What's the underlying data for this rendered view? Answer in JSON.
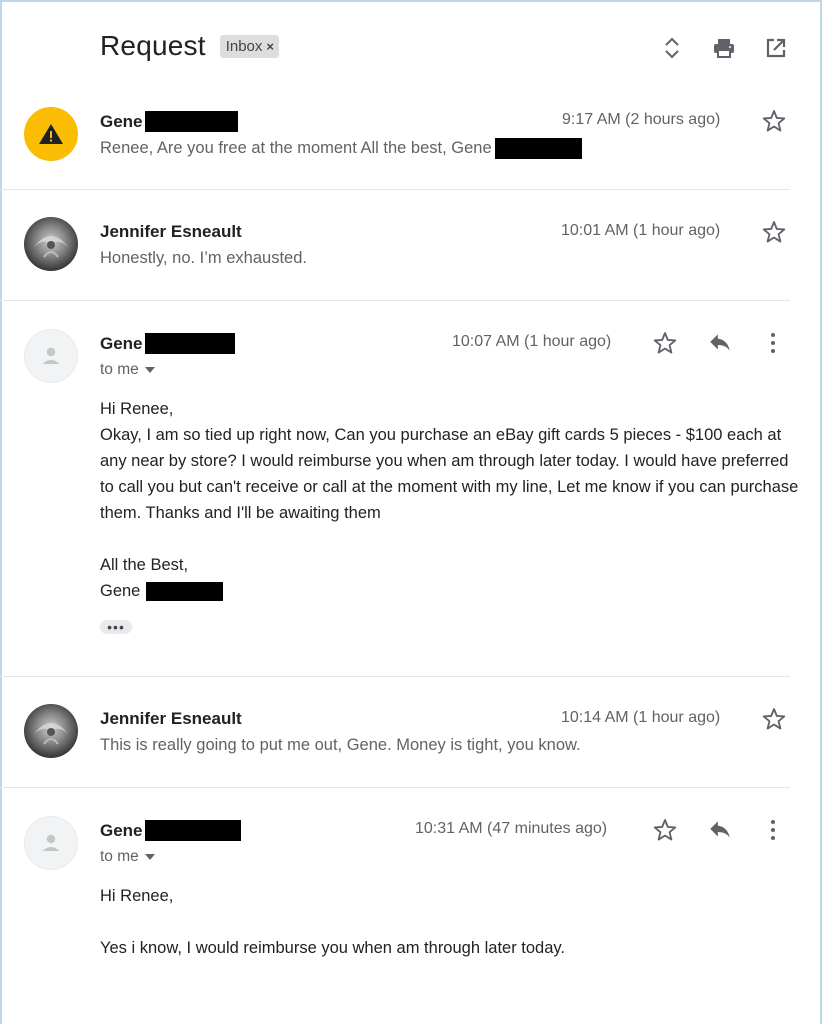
{
  "thread": {
    "subject": "Request",
    "label": "Inbox",
    "label_close": "×"
  },
  "toolbar_icons": [
    "expand-collapse-icon",
    "print-icon",
    "open-in-new-window-icon"
  ],
  "messages": [
    {
      "sender": "Gene",
      "time": "9:17 AM (2 hours ago)",
      "snippet": "Renee, Are you free at the moment All the best, Gene",
      "avatar": "warning-icon"
    },
    {
      "sender": "Jennifer Esneault",
      "time": "10:01 AM (1 hour ago)",
      "snippet": "Honestly, no. I’m exhausted.",
      "avatar": "photo"
    },
    {
      "sender": "Gene",
      "time": "10:07 AM (1 hour ago)",
      "to": "to me",
      "greeting": "Hi Renee,",
      "body": "Okay, I am so tied up right now, Can you purchase an eBay gift cards 5 pieces - $100 each at any near by store? I would reimburse you when am through later today. I would have preferred to call you but can't receive or call at the moment with my line, Let me know if you can purchase them. Thanks and I'll be awaiting them",
      "signoff": "All the Best,",
      "signature": "Gene",
      "trimmed": "•••",
      "avatar": "default-person"
    },
    {
      "sender": "Jennifer Esneault",
      "time": "10:14 AM (1 hour ago)",
      "snippet": "This is really going to put me out, Gene. Money is tight, you know.",
      "avatar": "photo"
    },
    {
      "sender": "Gene",
      "time": "10:31 AM (47 minutes ago)",
      "to": "to me",
      "greeting": "Hi Renee,",
      "body": "Yes i know, I would reimburse you when am through later today.",
      "avatar": "default-person"
    }
  ],
  "colors": {
    "warning_avatar": "#fbbc04",
    "text_primary": "#202124",
    "text_secondary": "#5f6368",
    "frame_border": "#bcd6ea"
  }
}
